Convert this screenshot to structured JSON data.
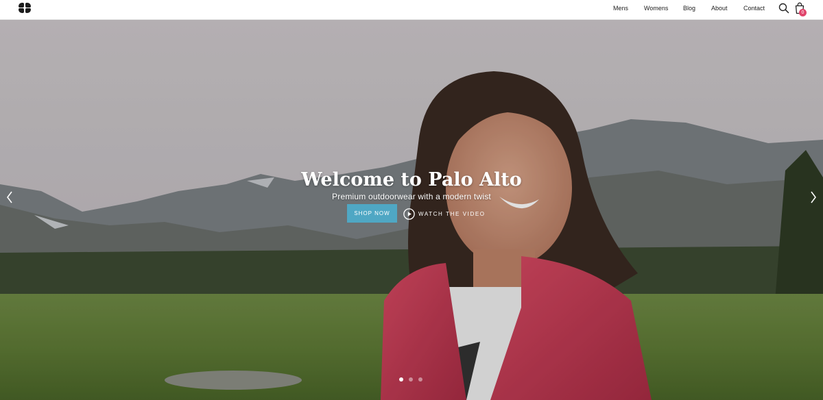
{
  "header": {
    "nav": [
      {
        "label": "Mens"
      },
      {
        "label": "Womens"
      },
      {
        "label": "Blog"
      },
      {
        "label": "About"
      },
      {
        "label": "Contact"
      }
    ],
    "cart_count": "0"
  },
  "hero": {
    "title": "Welcome to Palo Alto",
    "subtitle": "Premium outdoorwear with a modern twist",
    "shop_button": "SHOP NOW",
    "watch_label": "WATCH THE VIDEO",
    "slides": 3,
    "active_slide": 1
  },
  "colors": {
    "accent": "#4fa7c4",
    "badge": "#e0446b"
  },
  "icons": [
    "logo-icon",
    "search-icon",
    "cart-icon",
    "play-icon",
    "chevron-left-icon",
    "chevron-right-icon"
  ]
}
